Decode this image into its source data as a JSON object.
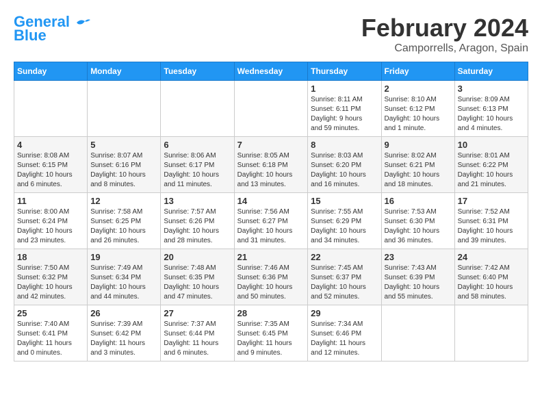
{
  "logo": {
    "line1": "General",
    "line2": "Blue"
  },
  "header": {
    "month": "February 2024",
    "location": "Camporrells, Aragon, Spain"
  },
  "weekdays": [
    "Sunday",
    "Monday",
    "Tuesday",
    "Wednesday",
    "Thursday",
    "Friday",
    "Saturday"
  ],
  "weeks": [
    [
      {
        "day": "",
        "info": ""
      },
      {
        "day": "",
        "info": ""
      },
      {
        "day": "",
        "info": ""
      },
      {
        "day": "",
        "info": ""
      },
      {
        "day": "1",
        "info": "Sunrise: 8:11 AM\nSunset: 6:11 PM\nDaylight: 9 hours\nand 59 minutes."
      },
      {
        "day": "2",
        "info": "Sunrise: 8:10 AM\nSunset: 6:12 PM\nDaylight: 10 hours\nand 1 minute."
      },
      {
        "day": "3",
        "info": "Sunrise: 8:09 AM\nSunset: 6:13 PM\nDaylight: 10 hours\nand 4 minutes."
      }
    ],
    [
      {
        "day": "4",
        "info": "Sunrise: 8:08 AM\nSunset: 6:15 PM\nDaylight: 10 hours\nand 6 minutes."
      },
      {
        "day": "5",
        "info": "Sunrise: 8:07 AM\nSunset: 6:16 PM\nDaylight: 10 hours\nand 8 minutes."
      },
      {
        "day": "6",
        "info": "Sunrise: 8:06 AM\nSunset: 6:17 PM\nDaylight: 10 hours\nand 11 minutes."
      },
      {
        "day": "7",
        "info": "Sunrise: 8:05 AM\nSunset: 6:18 PM\nDaylight: 10 hours\nand 13 minutes."
      },
      {
        "day": "8",
        "info": "Sunrise: 8:03 AM\nSunset: 6:20 PM\nDaylight: 10 hours\nand 16 minutes."
      },
      {
        "day": "9",
        "info": "Sunrise: 8:02 AM\nSunset: 6:21 PM\nDaylight: 10 hours\nand 18 minutes."
      },
      {
        "day": "10",
        "info": "Sunrise: 8:01 AM\nSunset: 6:22 PM\nDaylight: 10 hours\nand 21 minutes."
      }
    ],
    [
      {
        "day": "11",
        "info": "Sunrise: 8:00 AM\nSunset: 6:24 PM\nDaylight: 10 hours\nand 23 minutes."
      },
      {
        "day": "12",
        "info": "Sunrise: 7:58 AM\nSunset: 6:25 PM\nDaylight: 10 hours\nand 26 minutes."
      },
      {
        "day": "13",
        "info": "Sunrise: 7:57 AM\nSunset: 6:26 PM\nDaylight: 10 hours\nand 28 minutes."
      },
      {
        "day": "14",
        "info": "Sunrise: 7:56 AM\nSunset: 6:27 PM\nDaylight: 10 hours\nand 31 minutes."
      },
      {
        "day": "15",
        "info": "Sunrise: 7:55 AM\nSunset: 6:29 PM\nDaylight: 10 hours\nand 34 minutes."
      },
      {
        "day": "16",
        "info": "Sunrise: 7:53 AM\nSunset: 6:30 PM\nDaylight: 10 hours\nand 36 minutes."
      },
      {
        "day": "17",
        "info": "Sunrise: 7:52 AM\nSunset: 6:31 PM\nDaylight: 10 hours\nand 39 minutes."
      }
    ],
    [
      {
        "day": "18",
        "info": "Sunrise: 7:50 AM\nSunset: 6:32 PM\nDaylight: 10 hours\nand 42 minutes."
      },
      {
        "day": "19",
        "info": "Sunrise: 7:49 AM\nSunset: 6:34 PM\nDaylight: 10 hours\nand 44 minutes."
      },
      {
        "day": "20",
        "info": "Sunrise: 7:48 AM\nSunset: 6:35 PM\nDaylight: 10 hours\nand 47 minutes."
      },
      {
        "day": "21",
        "info": "Sunrise: 7:46 AM\nSunset: 6:36 PM\nDaylight: 10 hours\nand 50 minutes."
      },
      {
        "day": "22",
        "info": "Sunrise: 7:45 AM\nSunset: 6:37 PM\nDaylight: 10 hours\nand 52 minutes."
      },
      {
        "day": "23",
        "info": "Sunrise: 7:43 AM\nSunset: 6:39 PM\nDaylight: 10 hours\nand 55 minutes."
      },
      {
        "day": "24",
        "info": "Sunrise: 7:42 AM\nSunset: 6:40 PM\nDaylight: 10 hours\nand 58 minutes."
      }
    ],
    [
      {
        "day": "25",
        "info": "Sunrise: 7:40 AM\nSunset: 6:41 PM\nDaylight: 11 hours\nand 0 minutes."
      },
      {
        "day": "26",
        "info": "Sunrise: 7:39 AM\nSunset: 6:42 PM\nDaylight: 11 hours\nand 3 minutes."
      },
      {
        "day": "27",
        "info": "Sunrise: 7:37 AM\nSunset: 6:44 PM\nDaylight: 11 hours\nand 6 minutes."
      },
      {
        "day": "28",
        "info": "Sunrise: 7:35 AM\nSunset: 6:45 PM\nDaylight: 11 hours\nand 9 minutes."
      },
      {
        "day": "29",
        "info": "Sunrise: 7:34 AM\nSunset: 6:46 PM\nDaylight: 11 hours\nand 12 minutes."
      },
      {
        "day": "",
        "info": ""
      },
      {
        "day": "",
        "info": ""
      }
    ]
  ]
}
